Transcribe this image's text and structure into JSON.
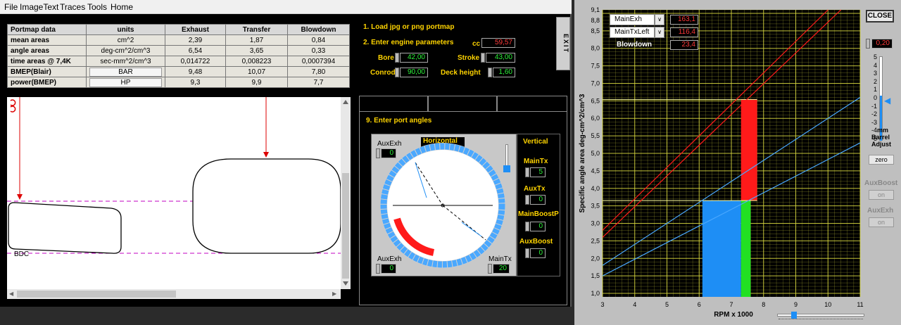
{
  "menu": [
    "File",
    "ImageText",
    "Traces",
    "Tools",
    "Home"
  ],
  "table": {
    "headers": [
      "Portmap data",
      "units",
      "Exhaust",
      "Transfer",
      "Blowdown"
    ],
    "rows": [
      {
        "label": "mean areas",
        "unit": "cm^2",
        "values": [
          "2,39",
          "1,87",
          "0,84"
        ]
      },
      {
        "label": "angle areas",
        "unit": "deg-cm^2/cm^3",
        "values": [
          "6,54",
          "3,65",
          "0,33"
        ]
      },
      {
        "label": "time areas @ 7,4K",
        "unit": "sec-mm^2/cm^3",
        "values": [
          "0,014722",
          "0,008223",
          "0,0007394"
        ]
      },
      {
        "label": "BMEP(Blair)",
        "unit": "BAR",
        "values": [
          "9,48",
          "10,07",
          "7,80"
        ]
      },
      {
        "label": "power(BMEP)",
        "unit": "HP",
        "values": [
          "9,3",
          "9,9",
          "7,7"
        ]
      }
    ]
  },
  "exit_label": "EXIT",
  "steps": {
    "load": "1. Load jpg or png portmap",
    "engine": "2. Enter engine parameters",
    "angles": "9. Enter port angles"
  },
  "engine": {
    "cc_label": "cc",
    "cc": "59,57",
    "bore_label": "Bore",
    "bore": "42,00",
    "stroke_label": "Stroke",
    "stroke": "43,00",
    "conrod_label": "Conrod",
    "conrod": "90,00",
    "deck_label": "Deck height",
    "deck": "1,60"
  },
  "portmap": {
    "bdc_label": "BDC"
  },
  "port_angles": {
    "auxexh_label": "AuxExh",
    "auxexh_top": "0",
    "auxexh_bottom": "0",
    "horizontal_label": "Horizontal",
    "maintx_label": "MainTx",
    "maintx_bottom": "20",
    "vertical_label": "Vertical",
    "v_maintx_label": "MainTx",
    "v_maintx": "5",
    "v_auxtx_label": "AuxTx",
    "v_auxtx": "0",
    "v_mainboost_label": "MainBoostP",
    "v_mainboost": "0",
    "v_auxboost_label": "AuxBoost",
    "v_auxboost": "0"
  },
  "legend": [
    {
      "name": "MainExh",
      "value": "163,1"
    },
    {
      "name": "MainTxLeft",
      "value": "116,4"
    },
    {
      "name": "Blowdown",
      "value": "23,4"
    }
  ],
  "close_label": "CLOSE",
  "barrel": {
    "value": "0,20",
    "ticks": [
      "5",
      "4",
      "3",
      "2",
      "1",
      "0",
      "-1",
      "-2",
      "-3",
      "-4",
      "-5"
    ],
    "label_mm": "mm",
    "label_barrel": "Barrel",
    "label_adjust": "Adjust",
    "zero_label": "zero"
  },
  "aux_boost": {
    "label": "AuxBoost",
    "button": "on"
  },
  "aux_exh": {
    "label": "AuxExh",
    "button": "on"
  },
  "colors": {
    "exhaust": "#1e8ef5",
    "transfer": "#22e022",
    "blowdown": "#ff1a1a",
    "grid": "#d8d840"
  },
  "chart_data": {
    "type": "line",
    "xlabel": "RPM x 1000",
    "ylabel": "Specific angle area  deg-cm^2/cm^3",
    "xlim": [
      3,
      11
    ],
    "ylim": [
      0.9,
      9.1
    ],
    "xticks": [
      "3",
      "4",
      "5",
      "6",
      "7",
      "8",
      "9",
      "10",
      "11"
    ],
    "yticks": [
      "9,1",
      "8,8",
      "8,5",
      "8,0",
      "7,5",
      "7,0",
      "6,5",
      "6,0",
      "5,5",
      "5,0",
      "4,5",
      "4,0",
      "3,5",
      "3,0",
      "2,5",
      "2,0",
      "1,5",
      "1,0"
    ],
    "grid": true,
    "series": [
      {
        "color": "#ff1a1a",
        "points": [
          [
            3,
            2.8
          ],
          [
            10,
            9.1
          ]
        ]
      },
      {
        "color": "#ff1a1a",
        "points": [
          [
            3,
            2.6
          ],
          [
            10.4,
            9.1
          ]
        ]
      },
      {
        "color": "#4aa8ff",
        "points": [
          [
            3,
            1.8
          ],
          [
            11,
            6.6
          ]
        ]
      },
      {
        "color": "#4aa8ff",
        "points": [
          [
            3,
            1.5
          ],
          [
            11,
            5.3
          ]
        ]
      }
    ],
    "bars": [
      {
        "color": "#1e8ef5",
        "x0": 6.1,
        "x1": 7.3,
        "y0": 0.9,
        "y1": 3.65
      },
      {
        "color": "#22e022",
        "x0": 7.3,
        "x1": 7.6,
        "y0": 0.9,
        "y1": 3.65
      },
      {
        "color": "#ff1a1a",
        "x0": 7.3,
        "x1": 7.8,
        "y0": 3.65,
        "y1": 6.54
      }
    ],
    "reference_lines": [
      6.54,
      3.65
    ]
  }
}
